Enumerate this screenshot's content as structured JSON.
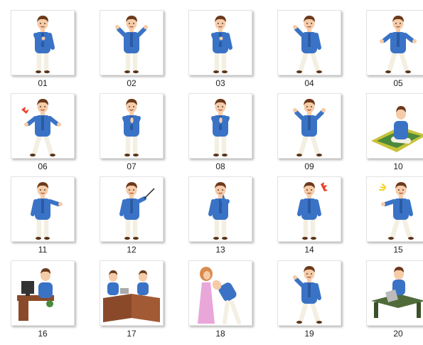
{
  "colors": {
    "shirt": "#3a73c6",
    "shirt_dark": "#2a5aa3",
    "pants": "#f3efe2",
    "pants_shade": "#d9d3bf",
    "skin": "#f6cba7",
    "hair": "#6b3a1c",
    "shoes": "#5a3418",
    "label_text": "#222222",
    "desk": "#8a4a2a",
    "rug": "#c8c23a",
    "rug_green": "#4a8a3a",
    "woman_dress": "#e9a6d9",
    "hijab": "#d98b4e",
    "accent_red": "#e8412c",
    "accent_yellow": "#f4d21c",
    "table": "#4f6b3a"
  },
  "items": [
    {
      "label": "01",
      "icon": "boy-standing-icon"
    },
    {
      "label": "02",
      "icon": "boy-peace-sign-icon"
    },
    {
      "label": "03",
      "icon": "boy-pointing-chest-icon"
    },
    {
      "label": "04",
      "icon": "boy-presenting-icon"
    },
    {
      "label": "05",
      "icon": "boy-shrugging-icon"
    },
    {
      "label": "06",
      "icon": "boy-angry-icon"
    },
    {
      "label": "07",
      "icon": "boy-praying-hands-icon"
    },
    {
      "label": "08",
      "icon": "boy-praying-hands-icon"
    },
    {
      "label": "09",
      "icon": "boy-thumbs-up-icon"
    },
    {
      "label": "10",
      "icon": "boy-sitting-on-prayer-mat-icon"
    },
    {
      "label": "11",
      "icon": "boy-explaining-icon"
    },
    {
      "label": "12",
      "icon": "boy-holding-pointer-icon"
    },
    {
      "label": "13",
      "icon": "boy-thinking-icon"
    },
    {
      "label": "14",
      "icon": "boy-confused-icon"
    },
    {
      "label": "15",
      "icon": "boy-pointing-icon"
    },
    {
      "label": "16",
      "icon": "boy-at-computer-desk-icon"
    },
    {
      "label": "17",
      "icon": "boys-at-desks-icon"
    },
    {
      "label": "18",
      "icon": "boy-greeting-mother-icon"
    },
    {
      "label": "19",
      "icon": "boy-gesturing-icon"
    },
    {
      "label": "20",
      "icon": "boy-with-laptop-icon"
    }
  ]
}
